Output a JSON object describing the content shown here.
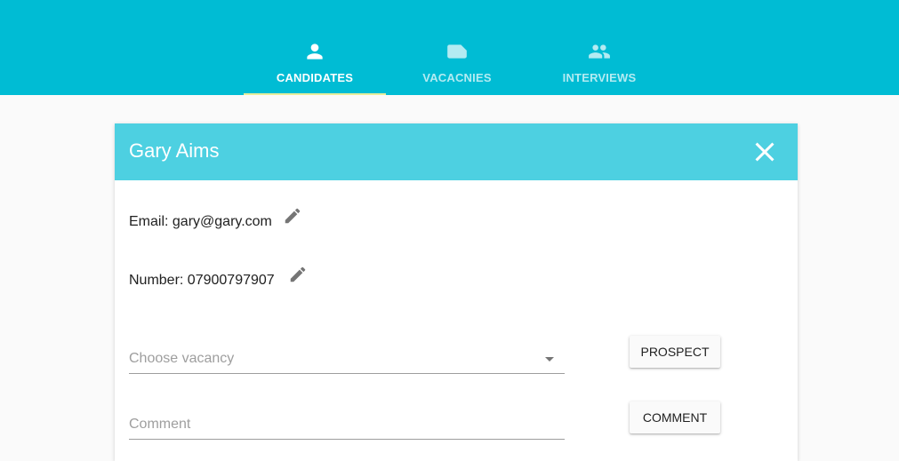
{
  "nav": {
    "tabs": [
      {
        "label": "CANDIDATES",
        "icon": "person-icon",
        "active": true
      },
      {
        "label": "VACACNIES",
        "icon": "label-icon",
        "active": false
      },
      {
        "label": "INTERVIEWS",
        "icon": "people-icon",
        "active": false
      }
    ]
  },
  "candidate": {
    "name": "Gary Aims",
    "email_line": "Email: gary@gary.com",
    "number_line": "Number: 07900797907"
  },
  "form": {
    "vacancy_placeholder": "Choose vacancy",
    "comment_placeholder": "Comment",
    "prospect_label": "PROSPECT",
    "comment_label": "COMMENT"
  },
  "colors": {
    "appbar": "#00bcd4",
    "card_header": "#4dd0e1",
    "tab_indicator": "#e6ee9c"
  }
}
